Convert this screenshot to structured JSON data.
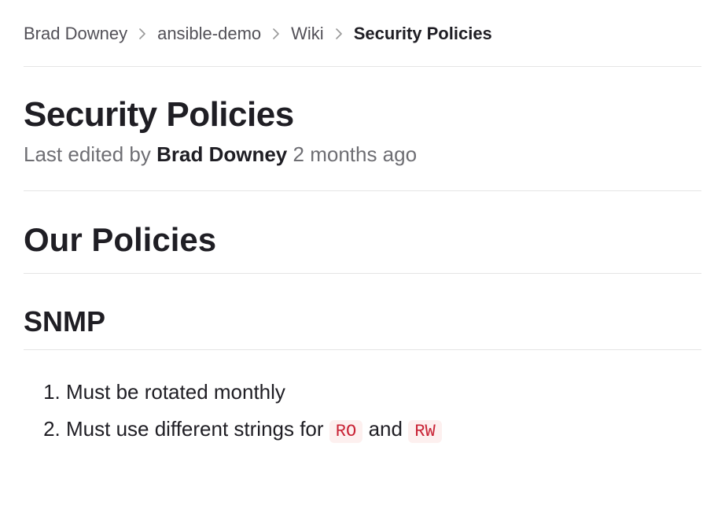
{
  "breadcrumb": {
    "items": [
      {
        "label": "Brad Downey",
        "current": false
      },
      {
        "label": "ansible-demo",
        "current": false
      },
      {
        "label": "Wiki",
        "current": false
      },
      {
        "label": "Security Policies",
        "current": true
      }
    ]
  },
  "page": {
    "title": "Security Policies",
    "last_edited_prefix": "Last edited by",
    "last_edited_author": "Brad Downey",
    "last_edited_time": "2 months ago"
  },
  "content": {
    "heading_policies": "Our Policies",
    "heading_snmp": "SNMP",
    "snmp_list": {
      "item1": "Must be rotated monthly",
      "item2_prefix": "Must use different strings for",
      "item2_code1": "RO",
      "item2_mid": "and",
      "item2_code2": "RW"
    }
  }
}
